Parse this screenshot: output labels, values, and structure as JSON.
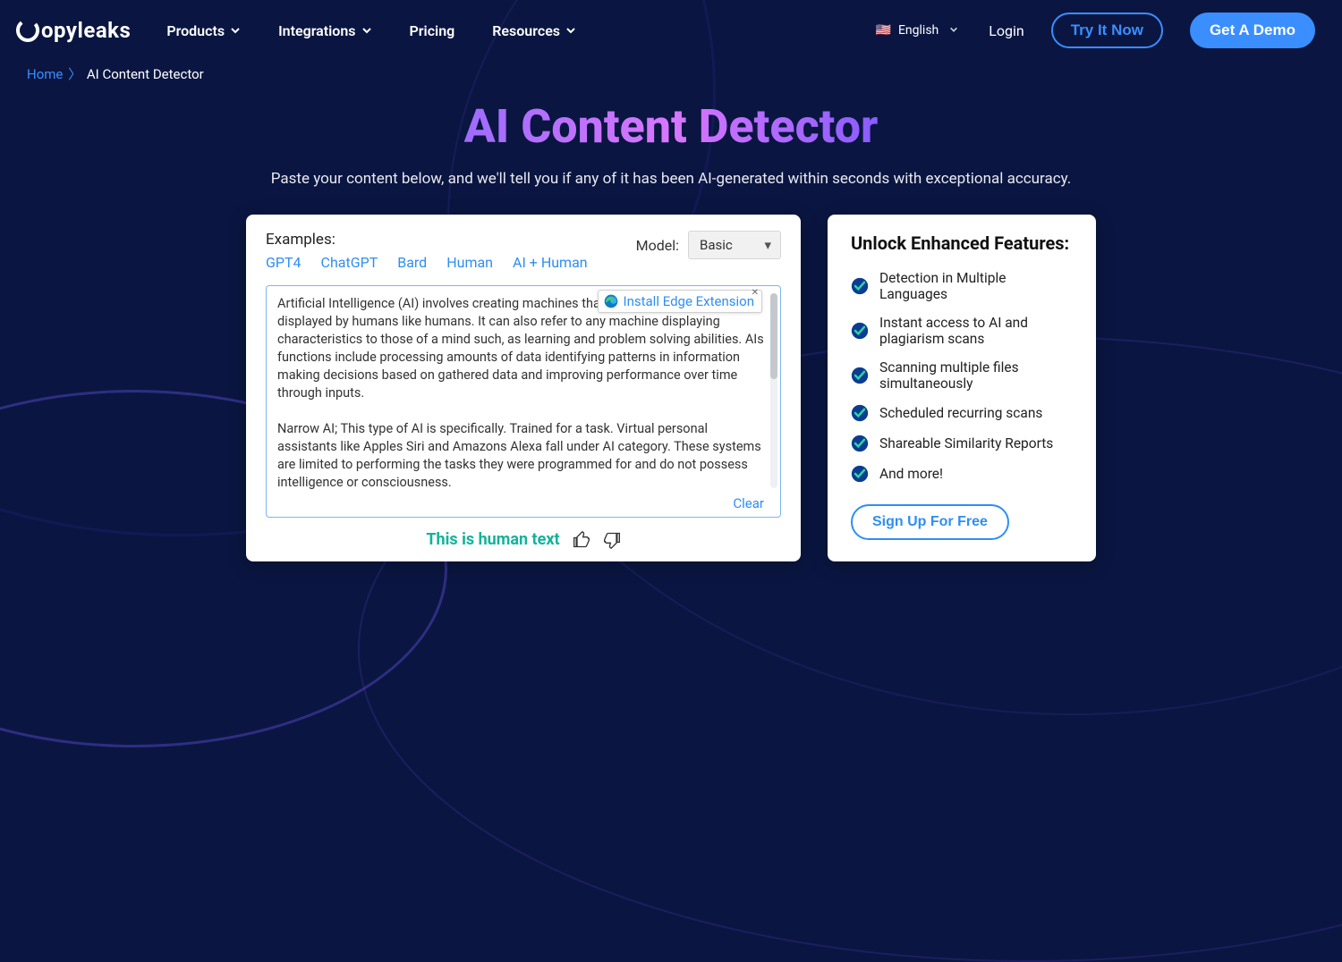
{
  "nav": {
    "brand": "opyleaks",
    "items": [
      {
        "label": "Products"
      },
      {
        "label": "Integrations"
      },
      {
        "label": "Pricing",
        "noChevron": true
      },
      {
        "label": "Resources"
      }
    ],
    "language": "English",
    "login": "Login",
    "try": "Try It Now",
    "demo": "Get A Demo"
  },
  "breadcrumb": {
    "home": "Home",
    "current": "AI Content Detector"
  },
  "hero": {
    "title": "AI Content Detector",
    "subtitle": "Paste your content below, and we'll tell you if any of it has been AI-generated within seconds with exceptional accuracy."
  },
  "detector": {
    "examples_label": "Examples:",
    "examples": [
      "GPT4",
      "ChatGPT",
      "Bard",
      "Human",
      "AI + Human"
    ],
    "model_label": "Model:",
    "model_value": "Basic",
    "text_p1": "Artificial Intelligence (AI) involves creating machines that mimic intelligence displayed by humans like humans. It can also refer to any machine displaying characteristics to those of a mind such, as learning and problem solving abilities. AIs functions include processing amounts of data identifying patterns in information making decisions based on gathered data and improving performance over time through inputs.",
    "text_p2": "Narrow AI; This type of AI is specifically. Trained for a task. Virtual personal assistants like Apples Siri and Amazons Alexa fall under AI category. These systems are limited to performing the tasks they were programmed for and do not possess intelligence or consciousness.",
    "clear": "Clear",
    "extension": "Install Edge Extension",
    "result": "This is human text"
  },
  "features": {
    "title": "Unlock Enhanced Features:",
    "items": [
      "Detection in Multiple Languages",
      "Instant access to AI and plagiarism scans",
      "Scanning multiple files simultaneously",
      "Scheduled recurring scans",
      "Shareable Similarity Reports",
      "And more!"
    ],
    "cta": "Sign Up For Free"
  }
}
